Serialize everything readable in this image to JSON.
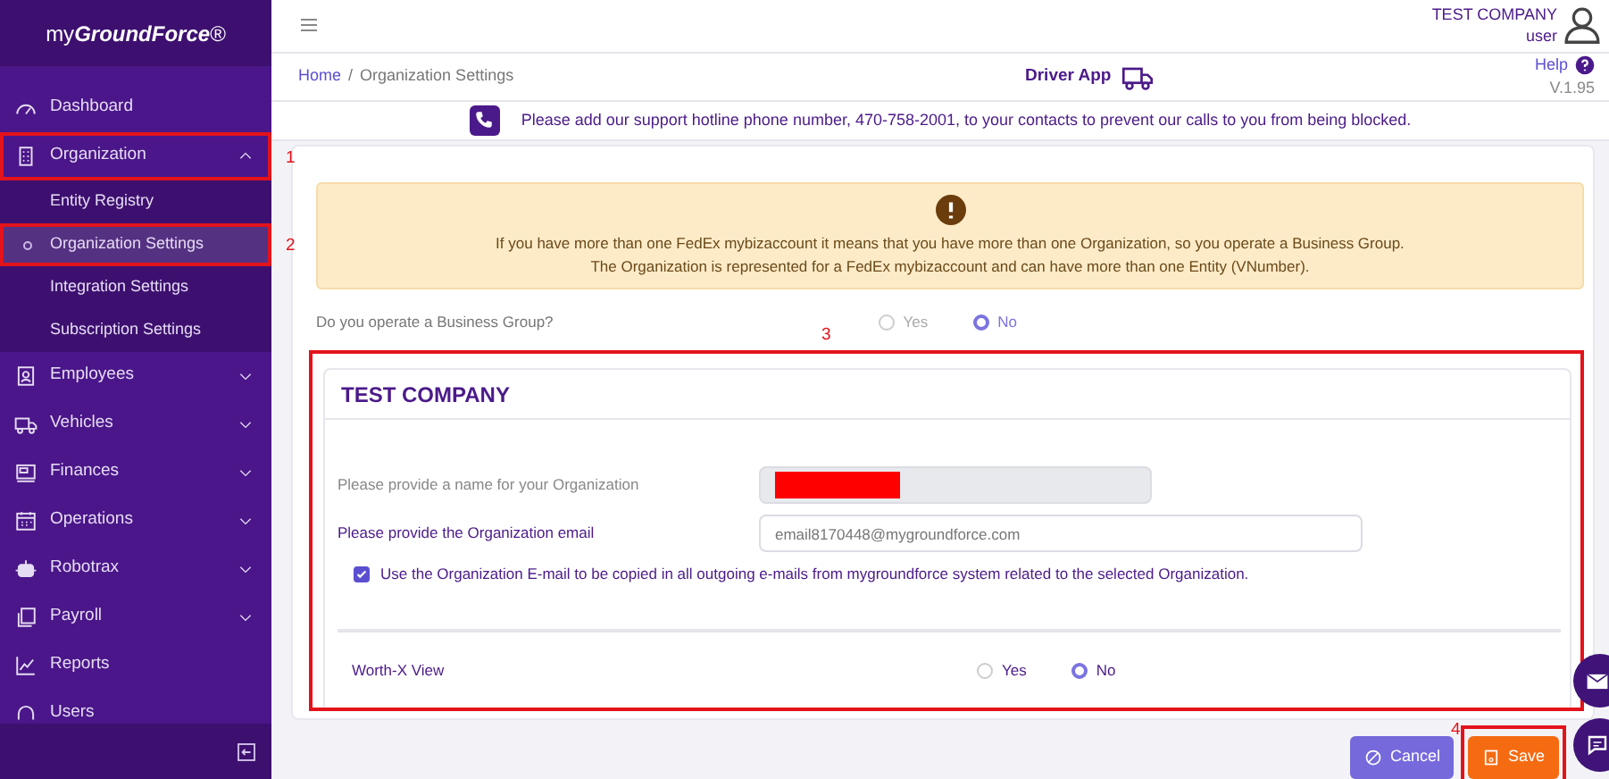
{
  "brand": "my**GroundForce**®",
  "sidebar": {
    "items": [
      {
        "label": "Dashboard",
        "kind": "link"
      },
      {
        "label": "Organization",
        "kind": "group",
        "expanded": true,
        "annotation": "1",
        "children": [
          {
            "label": "Entity Registry",
            "selected": false
          },
          {
            "label": "Organization Settings",
            "selected": true,
            "annotation": "2"
          },
          {
            "label": "Integration Settings",
            "selected": false
          },
          {
            "label": "Subscription Settings",
            "selected": false
          }
        ]
      },
      {
        "label": "Employees",
        "kind": "group",
        "expanded": false
      },
      {
        "label": "Vehicles",
        "kind": "group",
        "expanded": false
      },
      {
        "label": "Finances",
        "kind": "group",
        "expanded": false
      },
      {
        "label": "Operations",
        "kind": "group",
        "expanded": false
      },
      {
        "label": "Robotrax",
        "kind": "group",
        "expanded": false
      },
      {
        "label": "Payroll",
        "kind": "group",
        "expanded": false
      },
      {
        "label": "Reports",
        "kind": "link"
      },
      {
        "label": "Users",
        "kind": "link"
      }
    ]
  },
  "header": {
    "company": "TEST COMPANY",
    "role": "user"
  },
  "breadcrumb_separator": "/",
  "breadcrumb": [
    {
      "label": "Home",
      "selected": false
    },
    {
      "label": "Organization Settings",
      "selected": true
    }
  ],
  "driver_app": "Driver App",
  "help": {
    "label": "Help",
    "version": "V.1.95"
  },
  "notice": "Please add our support hotline phone number, 470-758-2001, to your contacts to prevent our calls to you from being blocked.",
  "warning": {
    "lines": [
      "If you have more than one FedEx mybizaccount it means that you have more than one Organization, so you operate a Business Group.",
      "The Organization is represented for a FedEx mybizaccount and can have more than one Entity (VNumber)."
    ]
  },
  "business_group": {
    "question": "Do you operate a Business Group?",
    "options": [
      {
        "label": "Yes",
        "selected": false
      },
      {
        "label": "No",
        "selected": true
      }
    ]
  },
  "company_card": {
    "title": "TEST COMPANY",
    "annotation": "3",
    "fields": [
      {
        "label": "Please provide a name for your Organization",
        "disabled": true,
        "redacted": true
      },
      {
        "label": "Please provide the Organization email",
        "disabled": false,
        "placeholder": "email8170448@mygroundforce.com"
      }
    ],
    "copy_option": {
      "label": "Use the Organization E-mail to be copied in all outgoing e-mails from mygroundforce system related to the selected Organization.",
      "checked": true
    },
    "worth_x": {
      "label": "Worth-X View",
      "options": [
        {
          "label": "Yes",
          "selected": false
        },
        {
          "label": "No",
          "selected": true
        }
      ]
    }
  },
  "buttons": [
    {
      "label": "Cancel",
      "kind": "cancel"
    },
    {
      "label": "Save",
      "kind": "save",
      "annotation": "4"
    }
  ]
}
